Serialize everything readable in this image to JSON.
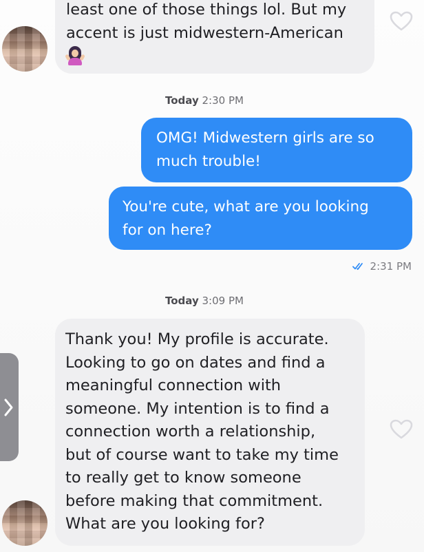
{
  "conversation": {
    "messages": [
      {
        "direction": "incoming",
        "lines": [
          "least one of those things lol. But my",
          "accent is just midwestern-American"
        ],
        "emoji": "person-shrugging"
      },
      {
        "direction": "outgoing",
        "lines": [
          "OMG! Midwestern girls are so",
          "much trouble!"
        ]
      },
      {
        "direction": "outgoing",
        "lines": [
          "You're cute, what are you looking",
          "for on here?"
        ]
      },
      {
        "direction": "incoming",
        "lines": [
          "Thank you! My profile is accurate.",
          "Looking to go on dates and find a",
          "meaningful connection with",
          "someone. My intention is to find a",
          "connection worth a relationship,",
          "but of course want to take my time",
          "to really get to know someone",
          "before making that commitment.",
          "What are you looking for?"
        ]
      }
    ],
    "timestamps": [
      {
        "day": "Today",
        "time": "2:30 PM"
      },
      {
        "day": "Today",
        "time": "3:09 PM"
      }
    ],
    "read_receipt": {
      "time": "2:31 PM",
      "icon": "double-check-icon"
    }
  },
  "icons": {
    "like": "heart-outline-icon",
    "side_handle": "chevron-right-icon"
  },
  "colors": {
    "outgoing_bubble": "#2f8cf6",
    "incoming_bubble": "#efeff1",
    "heart_outline": "#d9d9de",
    "side_handle": "#8e8e93"
  }
}
